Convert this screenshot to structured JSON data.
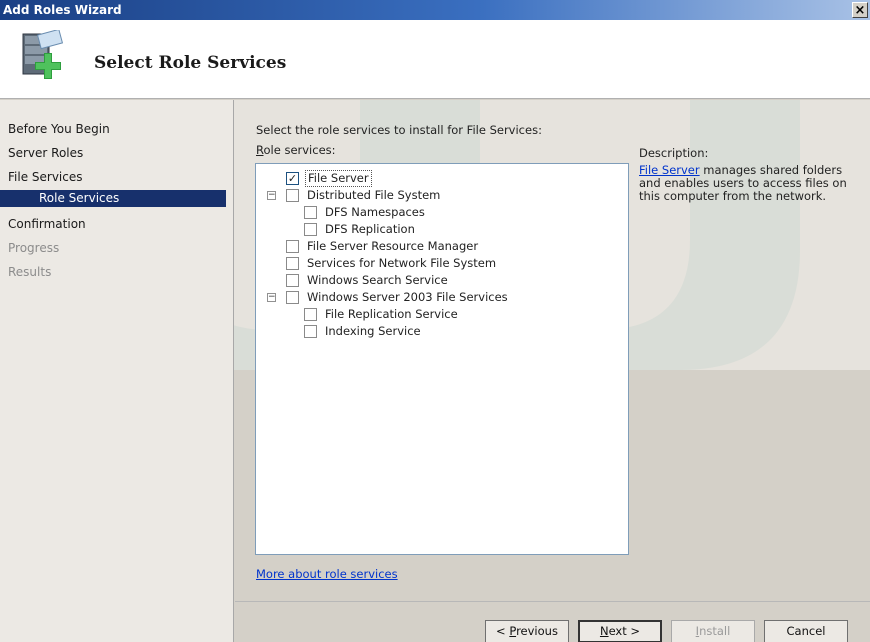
{
  "window": {
    "title": "Add Roles Wizard",
    "close_glyph": "×"
  },
  "header": {
    "title": "Select Role Services",
    "icon": "server-add-role-icon"
  },
  "nav": {
    "items": [
      {
        "label": "Before You Begin",
        "state": "normal"
      },
      {
        "label": "Server Roles",
        "state": "normal"
      },
      {
        "label": "File Services",
        "state": "normal"
      },
      {
        "label": "Role Services",
        "state": "active"
      },
      {
        "label": "Confirmation",
        "state": "normal"
      },
      {
        "label": "Progress",
        "state": "disabled"
      },
      {
        "label": "Results",
        "state": "disabled"
      }
    ]
  },
  "main": {
    "prompt": "Select the role services to install for File Services:",
    "role_services_label_accel": "R",
    "role_services_label_rest": "ole services:",
    "role_services": [
      {
        "label": "File Server",
        "checked": true,
        "indent": 1,
        "expander": ""
      },
      {
        "label": "Distributed File System",
        "checked": false,
        "indent": 1,
        "expander": "−"
      },
      {
        "label": "DFS Namespaces",
        "checked": false,
        "indent": 2,
        "expander": ""
      },
      {
        "label": "DFS Replication",
        "checked": false,
        "indent": 2,
        "expander": ""
      },
      {
        "label": "File Server Resource Manager",
        "checked": false,
        "indent": 1,
        "expander": ""
      },
      {
        "label": "Services for Network File System",
        "checked": false,
        "indent": 1,
        "expander": ""
      },
      {
        "label": "Windows Search Service",
        "checked": false,
        "indent": 1,
        "expander": ""
      },
      {
        "label": "Windows Server 2003 File Services",
        "checked": false,
        "indent": 1,
        "expander": "−"
      },
      {
        "label": "File Replication Service",
        "checked": false,
        "indent": 2,
        "expander": ""
      },
      {
        "label": "Indexing Service",
        "checked": false,
        "indent": 2,
        "expander": ""
      }
    ],
    "more_link": "More about role services",
    "description": {
      "heading": "Description:",
      "link": "File Server",
      "text": " manages shared folders and enables users to access files on this computer from the network."
    }
  },
  "buttons": {
    "previous_prefix": "< ",
    "previous_accel": "P",
    "previous_rest": "revious",
    "next_accel": "N",
    "next_rest": "ext >",
    "install_accel": "I",
    "install_rest": "nstall",
    "cancel": "Cancel"
  },
  "colors": {
    "nav_active_bg": "#17306c",
    "link": "#0033cc",
    "titlebar": "#1a3f84"
  }
}
